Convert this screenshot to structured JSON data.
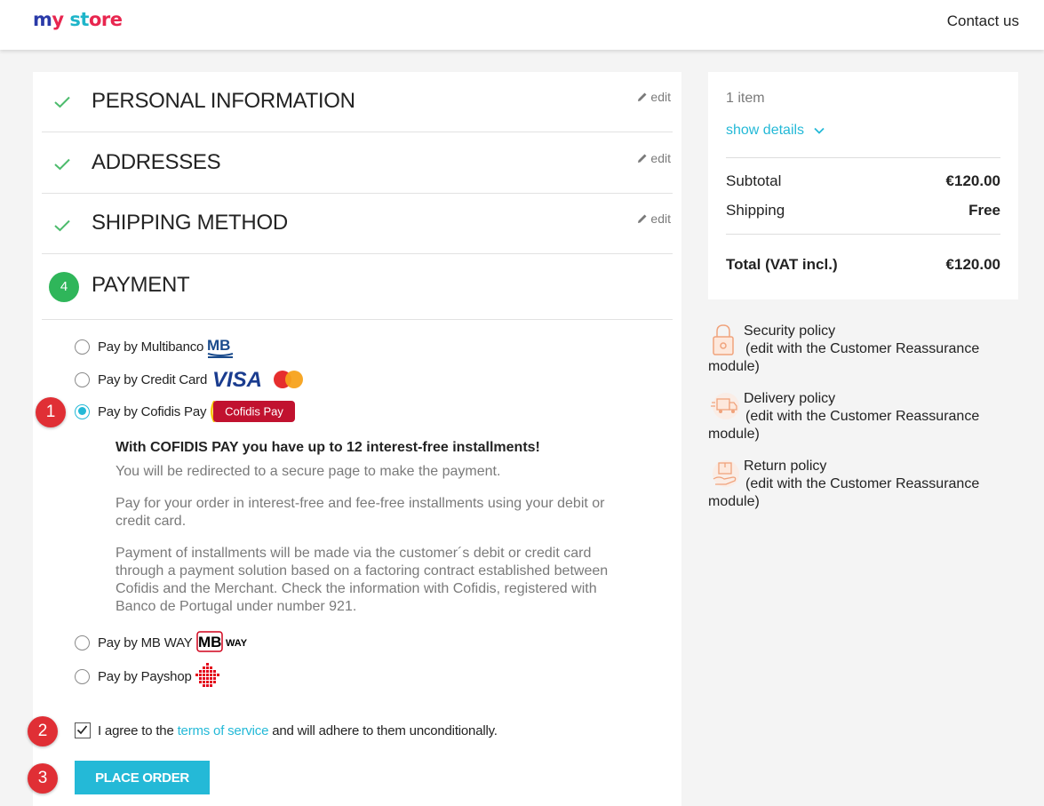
{
  "header": {
    "logo_parts": [
      "m",
      "y ",
      "st",
      "ore"
    ],
    "contact": "Contact us"
  },
  "steps": [
    {
      "title": "PERSONAL INFORMATION",
      "edit": "edit"
    },
    {
      "title": "ADDRESSES",
      "edit": "edit"
    },
    {
      "title": "SHIPPING METHOD",
      "edit": "edit"
    },
    {
      "number": "4",
      "title": "PAYMENT"
    }
  ],
  "payment_options": [
    {
      "label": "Pay by Multibanco",
      "logo": "MB",
      "checked": false
    },
    {
      "label": "Pay by Credit Card",
      "logo": "VISA",
      "checked": false
    },
    {
      "label": "Pay by Cofidis Pay",
      "logo": "Cofidis Pay",
      "checked": true
    },
    {
      "label": "Pay by MB WAY",
      "logo": "MB",
      "logo_suffix": "WAY",
      "checked": false
    },
    {
      "label": "Pay by Payshop",
      "logo": "payshop-icon",
      "checked": false
    }
  ],
  "cofidis": {
    "title": "With COFIDIS PAY you have up to 12 interest-free installments!",
    "p1": "You will be redirected to a secure page to make the payment.",
    "p2": "Pay for your order in interest-free and fee-free installments using your debit or credit card.",
    "p3": "Payment of installments will be made via the customer´s debit or credit card through a payment solution based on a factoring contract established between Cofidis and the Merchant. Check the information with Cofidis, registered with Banco de Portugal under number 921."
  },
  "agree": {
    "before": "I agree to the ",
    "link": "terms of service",
    "after": " and will adhere to them unconditionally.",
    "checked": true
  },
  "place_order": "PLACE ORDER",
  "annotations": [
    "1",
    "2",
    "3"
  ],
  "summary": {
    "items": "1 item",
    "show_details": "show details",
    "subtotal_label": "Subtotal",
    "subtotal_value": "€120.00",
    "shipping_label": "Shipping",
    "shipping_value": "Free",
    "total_label": "Total (VAT incl.)",
    "total_value": "€120.00"
  },
  "reassurance": [
    {
      "title": "Security policy",
      "desc": "(edit with the Customer Reassurance module)"
    },
    {
      "title": "Delivery policy",
      "desc": "(edit with the Customer Reassurance module)"
    },
    {
      "title": "Return policy",
      "desc": "(edit with the Customer Reassurance module)"
    }
  ],
  "colors": {
    "accent": "#24b9d7",
    "success": "#2fb65a",
    "annotation": "#e02f35"
  }
}
